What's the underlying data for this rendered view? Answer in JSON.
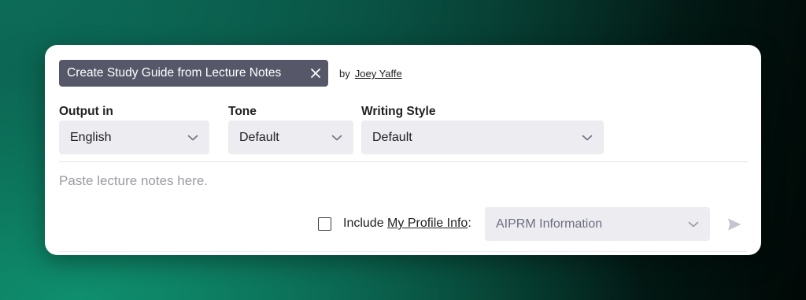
{
  "prompt": {
    "title": "Create Study Guide from Lecture Notes",
    "by_label": "by",
    "author": "Joey Yaffe"
  },
  "fields": {
    "output": {
      "label": "Output in",
      "value": "English"
    },
    "tone": {
      "label": "Tone",
      "value": "Default"
    },
    "style": {
      "label": "Writing Style",
      "value": "Default"
    }
  },
  "notes": {
    "placeholder": "Paste lecture notes here.",
    "value": ""
  },
  "profile": {
    "include_label": "Include",
    "link_label": "My Profile Info",
    "colon": ":",
    "checked": false
  },
  "aiprm": {
    "value": "AIPRM Information"
  },
  "icons": {
    "close": "close-icon",
    "chevron": "chevron-down-icon",
    "send": "send-icon"
  },
  "colors": {
    "chip_bg": "#565869",
    "select_bg": "#ececf1",
    "placeholder": "#9b9ba5",
    "send_icon": "#c5c5d2"
  }
}
